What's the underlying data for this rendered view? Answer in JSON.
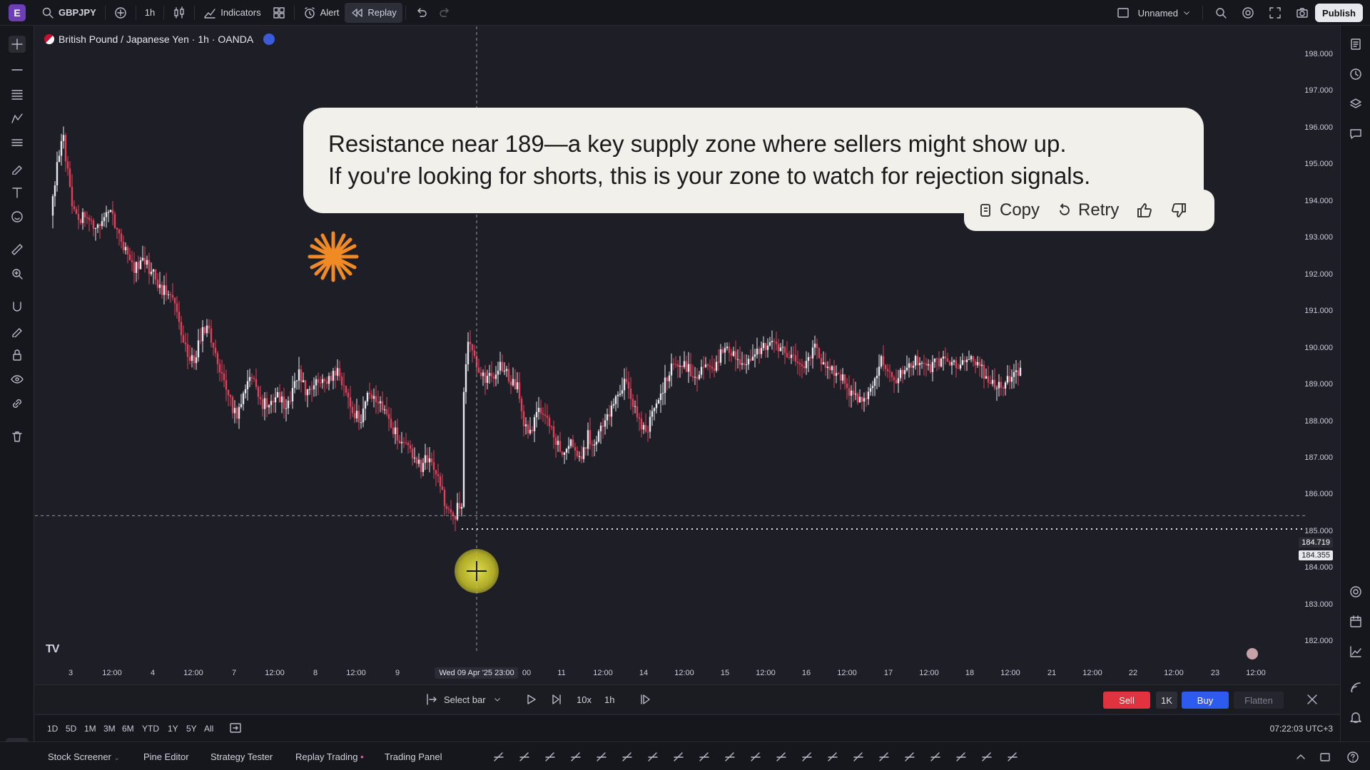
{
  "topbar": {
    "avatar_letter": "E",
    "symbol": "GBPJPY",
    "interval": "1h",
    "indicators_label": "Indicators",
    "alert_label": "Alert",
    "replay_label": "Replay",
    "layout_name": "Unnamed",
    "publish_label": "Publish"
  },
  "chart": {
    "title": "British Pound / Japanese Yen · 1h · OANDA",
    "price_labels": [
      "198.000",
      "197.000",
      "196.000",
      "195.000",
      "194.000",
      "193.000",
      "192.000",
      "191.000",
      "190.000",
      "189.000",
      "188.000",
      "187.000",
      "186.000",
      "185.000",
      "184.000",
      "183.000",
      "182.000"
    ],
    "crosshair_price": "184.719",
    "last_price": "184.355",
    "time_labels": [
      {
        "text": "3"
      },
      {
        "text": "12:00"
      },
      {
        "text": "4"
      },
      {
        "text": "12:00"
      },
      {
        "text": "7"
      },
      {
        "text": "12:00"
      },
      {
        "text": "8"
      },
      {
        "text": "12:00"
      },
      {
        "text": "9"
      },
      {
        "text": "00"
      },
      {
        "text": "11"
      },
      {
        "text": "12:00"
      },
      {
        "text": "14"
      },
      {
        "text": "12:00"
      },
      {
        "text": "15"
      },
      {
        "text": "12:00"
      },
      {
        "text": "16"
      },
      {
        "text": "12:00"
      },
      {
        "text": "17"
      },
      {
        "text": "12:00"
      },
      {
        "text": "18"
      },
      {
        "text": "12:00"
      },
      {
        "text": "21"
      },
      {
        "text": "12:00"
      },
      {
        "text": "22"
      },
      {
        "text": "12:00"
      },
      {
        "text": "23"
      },
      {
        "text": "12:00"
      }
    ],
    "crosshair_time": "Wed 09 Apr '25   23:00",
    "logo": "TV"
  },
  "callout": {
    "line1": "Resistance near 189—a key supply zone where sellers might show up.",
    "line2": "If you're looking for shorts, this is your zone to watch for rejection signals.",
    "copy_label": "Copy",
    "retry_label": "Retry"
  },
  "replay": {
    "select_bar_label": "Select bar",
    "speed": "10x",
    "step_interval": "1h",
    "sell_label": "Sell",
    "qty_label": "1K",
    "buy_label": "Buy",
    "flatten_label": "Flatten"
  },
  "ranges": [
    "1D",
    "5D",
    "1M",
    "3M",
    "6M",
    "YTD",
    "1Y",
    "5Y",
    "All"
  ],
  "clock": "07:22:03 UTC+3",
  "bottom_tabs": [
    "Stock Screener",
    "Pine Editor",
    "Strategy Tester",
    "Replay Trading",
    "Trading Panel"
  ],
  "colors": {
    "up": "#e8e9ee",
    "down": "#e0405a",
    "accent": "#2d5bf0",
    "sell": "#e0333f"
  },
  "chart_data": {
    "type": "candlestick",
    "title": "British Pound / Japanese Yen · 1h · OANDA",
    "ylim": [
      181.6,
      198.4
    ],
    "path_close": [
      [
        0,
        192.9
      ],
      [
        4,
        193.8
      ],
      [
        8,
        194.7
      ],
      [
        12,
        195.0
      ],
      [
        16,
        194.1
      ],
      [
        20,
        193.0
      ],
      [
        26,
        192.8
      ],
      [
        32,
        192.9
      ],
      [
        40,
        192.6
      ],
      [
        48,
        192.8
      ],
      [
        56,
        193.1
      ],
      [
        62,
        192.4
      ],
      [
        70,
        191.9
      ],
      [
        78,
        191.5
      ],
      [
        86,
        191.7
      ],
      [
        94,
        191.4
      ],
      [
        100,
        191.0
      ],
      [
        108,
        190.8
      ],
      [
        114,
        190.5
      ],
      [
        120,
        190.0
      ],
      [
        128,
        189.2
      ],
      [
        134,
        188.9
      ],
      [
        140,
        189.6
      ],
      [
        146,
        189.9
      ],
      [
        152,
        189.3
      ],
      [
        160,
        188.6
      ],
      [
        168,
        187.8
      ],
      [
        174,
        187.4
      ],
      [
        180,
        188.2
      ],
      [
        186,
        188.6
      ],
      [
        192,
        188.2
      ],
      [
        198,
        187.7
      ],
      [
        206,
        187.9
      ],
      [
        212,
        188.1
      ],
      [
        220,
        187.5
      ],
      [
        226,
        188.2
      ],
      [
        232,
        188.7
      ],
      [
        238,
        188.1
      ],
      [
        246,
        188.4
      ],
      [
        252,
        188.5
      ],
      [
        260,
        188.4
      ],
      [
        268,
        188.6
      ],
      [
        276,
        188.0
      ],
      [
        282,
        187.5
      ],
      [
        290,
        187.4
      ],
      [
        296,
        187.9
      ],
      [
        302,
        188.0
      ],
      [
        310,
        187.6
      ],
      [
        316,
        187.3
      ],
      [
        322,
        187.0
      ],
      [
        330,
        186.7
      ],
      [
        338,
        186.3
      ],
      [
        346,
        186.0
      ],
      [
        352,
        186.3
      ],
      [
        360,
        185.8
      ],
      [
        366,
        185.3
      ],
      [
        372,
        184.8
      ],
      [
        376,
        184.6
      ],
      [
        380,
        184.9
      ],
      [
        384,
        185.0
      ],
      [
        386,
        188.2
      ],
      [
        388,
        189.0
      ],
      [
        390,
        189.6
      ],
      [
        394,
        189.3
      ],
      [
        400,
        188.7
      ],
      [
        406,
        188.4
      ],
      [
        414,
        188.6
      ],
      [
        420,
        188.9
      ],
      [
        428,
        188.5
      ],
      [
        436,
        188.2
      ],
      [
        442,
        187.3
      ],
      [
        448,
        186.9
      ],
      [
        456,
        187.6
      ],
      [
        464,
        187.4
      ],
      [
        470,
        186.9
      ],
      [
        478,
        186.5
      ],
      [
        484,
        186.7
      ],
      [
        490,
        186.5
      ],
      [
        496,
        186.3
      ],
      [
        502,
        186.9
      ],
      [
        508,
        186.7
      ],
      [
        514,
        187.1
      ],
      [
        522,
        187.5
      ],
      [
        530,
        188.1
      ],
      [
        536,
        188.4
      ],
      [
        544,
        187.8
      ],
      [
        550,
        187.2
      ],
      [
        556,
        187.0
      ],
      [
        562,
        187.4
      ],
      [
        568,
        187.8
      ],
      [
        574,
        188.4
      ],
      [
        580,
        188.7
      ],
      [
        588,
        188.9
      ],
      [
        596,
        188.7
      ],
      [
        604,
        188.6
      ],
      [
        612,
        188.8
      ],
      [
        620,
        188.8
      ],
      [
        628,
        189.3
      ],
      [
        636,
        189.1
      ],
      [
        644,
        188.9
      ],
      [
        652,
        189.0
      ],
      [
        660,
        189.2
      ],
      [
        668,
        189.4
      ],
      [
        676,
        189.3
      ],
      [
        684,
        189.2
      ],
      [
        692,
        189.0
      ],
      [
        700,
        188.8
      ],
      [
        708,
        189.0
      ],
      [
        714,
        189.4
      ],
      [
        720,
        189.0
      ],
      [
        728,
        188.7
      ],
      [
        736,
        188.6
      ],
      [
        744,
        188.2
      ],
      [
        752,
        187.9
      ],
      [
        758,
        187.8
      ],
      [
        764,
        188.1
      ],
      [
        770,
        188.5
      ],
      [
        776,
        188.9
      ],
      [
        782,
        188.6
      ],
      [
        790,
        188.4
      ],
      [
        798,
        188.7
      ],
      [
        806,
        188.9
      ],
      [
        814,
        188.9
      ],
      [
        822,
        188.8
      ],
      [
        830,
        188.9
      ],
      [
        838,
        189.0
      ],
      [
        846,
        188.9
      ],
      [
        854,
        188.9
      ],
      [
        862,
        188.9
      ],
      [
        870,
        188.7
      ],
      [
        878,
        188.4
      ],
      [
        886,
        188.2
      ],
      [
        894,
        188.5
      ],
      [
        900,
        188.6
      ],
      [
        906,
        188.7
      ]
    ]
  }
}
